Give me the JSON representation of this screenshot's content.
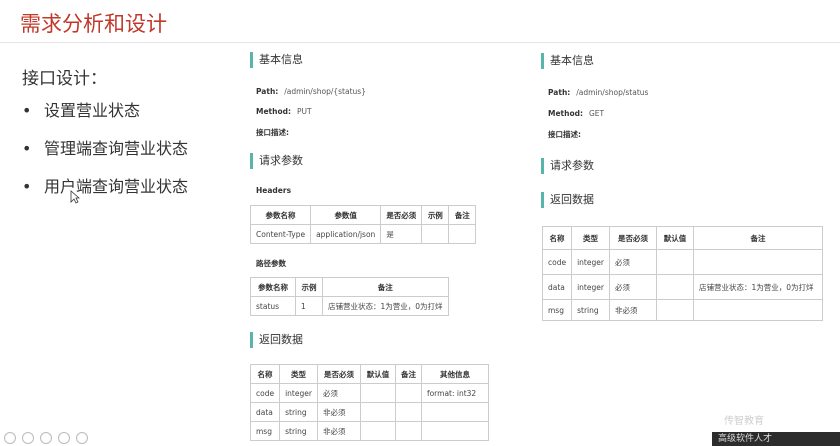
{
  "slide": {
    "title": "需求分析和设计",
    "section_heading": "接口设计：",
    "bullets": [
      "设置营业状态",
      "管理端查询营业状态",
      "用户端查询营业状态"
    ]
  },
  "left_api": {
    "basic_heading": "基本信息",
    "path_label": "Path:",
    "path_value": "/admin/shop/{status}",
    "method_label": "Method:",
    "method_value": "PUT",
    "desc_label": "接口描述:",
    "request_heading": "请求参数",
    "headers_label": "Headers",
    "headers_table": {
      "columns": [
        "参数名称",
        "参数值",
        "是否必须",
        "示例",
        "备注"
      ],
      "rows": [
        [
          "Content-Type",
          "application/json",
          "是",
          "",
          ""
        ]
      ]
    },
    "path_params_label": "路径参数",
    "path_params_table": {
      "columns": [
        "参数名称",
        "示例",
        "备注"
      ],
      "rows": [
        [
          "status",
          "1",
          "店铺营业状态：1为营业，0为打烊"
        ]
      ]
    },
    "response_heading": "返回数据",
    "response_table": {
      "columns": [
        "名称",
        "类型",
        "是否必须",
        "默认值",
        "备注",
        "其他信息"
      ],
      "rows": [
        [
          "code",
          "integer",
          "必须",
          "",
          "",
          "format: int32"
        ],
        [
          "data",
          "string",
          "非必须",
          "",
          "",
          ""
        ],
        [
          "msg",
          "string",
          "非必须",
          "",
          "",
          ""
        ]
      ]
    }
  },
  "right_api": {
    "basic_heading": "基本信息",
    "path_label": "Path:",
    "path_value": "/admin/shop/status",
    "method_label": "Method:",
    "method_value": "GET",
    "desc_label": "接口描述:",
    "request_heading": "请求参数",
    "response_heading": "返回数据",
    "response_table": {
      "columns": [
        "名称",
        "类型",
        "是否必须",
        "默认值",
        "备注"
      ],
      "rows": [
        [
          "code",
          "integer",
          "必须",
          "",
          ""
        ],
        [
          "data",
          "integer",
          "必须",
          "",
          "店铺营业状态：1为营业，0为打烊"
        ],
        [
          "msg",
          "string",
          "非必须",
          "",
          ""
        ]
      ]
    }
  },
  "footer": {
    "brand_text": "高级软件人才",
    "watermark_text": "传智教育"
  },
  "colors": {
    "title": "#c0392b",
    "accent_bar": "#5ab4ac"
  }
}
